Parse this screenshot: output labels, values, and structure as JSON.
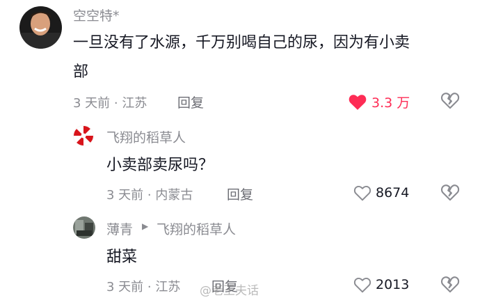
{
  "comments": [
    {
      "username": "空空特*",
      "text_line1": "一旦没有了水源，千万别喝自己的尿，因为有小卖",
      "text_line2": "部",
      "meta": "3 天前 · 江苏",
      "reply_label": "回复",
      "likes": "3.3 万",
      "liked": true,
      "like_color": "#fe2c55"
    },
    {
      "username": "飞翔的稻草人",
      "text": "小卖部卖尿吗？",
      "meta": "3 天前 · 内蒙古",
      "reply_label": "回复",
      "likes": "8674",
      "liked": false
    },
    {
      "username": "薄青",
      "reply_to_arrow": "▶",
      "reply_to": "飞翔的稻草人",
      "text": "甜菜",
      "meta": "3 天前 · 江苏",
      "reply_label": "回复",
      "likes": "2013",
      "liked": false
    }
  ],
  "watermark": "@老王夫话",
  "icons": {
    "like": "heart-icon",
    "dislike": "broken-heart-icon"
  }
}
